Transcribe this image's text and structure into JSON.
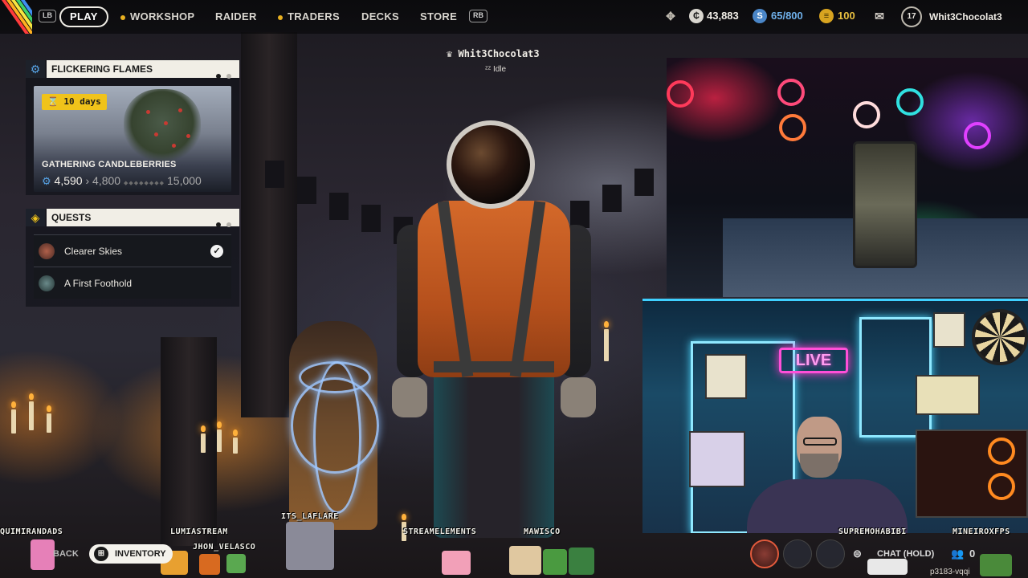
{
  "topbar": {
    "lb": "LB",
    "rb": "RB",
    "nav": [
      {
        "label": "PLAY",
        "active": true,
        "dot": false
      },
      {
        "label": "WORKSHOP",
        "active": false,
        "dot": true
      },
      {
        "label": "RAIDER",
        "active": false,
        "dot": false
      },
      {
        "label": "TRADERS",
        "active": false,
        "dot": true
      },
      {
        "label": "DECKS",
        "active": false,
        "dot": false
      },
      {
        "label": "STORE",
        "active": false,
        "dot": false
      }
    ],
    "coins": "43,883",
    "storage": "65/800",
    "premium": "100",
    "level": "17",
    "username": "Whit3Chocolat3"
  },
  "event": {
    "title": "FLICKERING FLAMES",
    "timer": "10 days",
    "task": "GATHERING CANDLEBERRIES",
    "progress": "4,590",
    "next_milestone": "4,800",
    "goal": "15,000"
  },
  "quests": {
    "title": "QUESTS",
    "items": [
      {
        "label": "Clearer Skies",
        "completed": true
      },
      {
        "label": "A First Foothold",
        "completed": false
      }
    ]
  },
  "player": {
    "name": "Whit3Chocolat3",
    "status": "Idle"
  },
  "stream_overlay": {
    "chatters": [
      "QUIMIRANDADS",
      "LUMIASTREAM",
      "ITS_LAFLARE",
      "JHON_VELASCO",
      "STREAMELEMENTS",
      "MAWISCO",
      "SUPREMOHABIBI",
      "MINEIROXFPS"
    ],
    "live_sign": "LIVE"
  },
  "bottom": {
    "back_label": "BACK",
    "inventory_label": "INVENTORY",
    "chat_label": "CHAT (HOLD)",
    "party_count": "0",
    "session_id": "p3183-vqqi"
  },
  "colors": {
    "accent_yellow": "#f0c31a",
    "accent_blue": "#57a4e6",
    "panel_header": "#f1eee6"
  }
}
